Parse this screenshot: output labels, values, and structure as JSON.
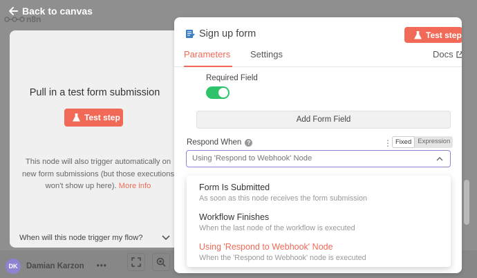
{
  "top": {
    "back_label": "Back to canvas",
    "logo_text": "n8n"
  },
  "left_panel": {
    "title": "Pull in a test form submission",
    "test_button": "Test step",
    "description": "This node will also trigger automatically on new form submissions (but those executions won't show up here).",
    "more_info": "More info",
    "footer_question": "When will this node trigger my flow?"
  },
  "user": {
    "initials": "DK",
    "name": "Damian Karzon",
    "menu": "•••"
  },
  "node_panel": {
    "title": "Sign up form",
    "test_button": "Test step",
    "tabs": [
      {
        "label": "Parameters",
        "active": true
      },
      {
        "label": "Settings",
        "active": false
      }
    ],
    "docs_label": "Docs",
    "required_field_label": "Required Field",
    "required_field_on": true,
    "add_field_button": "Add Form Field",
    "respond_when": {
      "label": "Respond When",
      "help": "?",
      "mode_fixed": "Fixed",
      "mode_expression": "Expression",
      "value": "Using 'Respond to Webhook' Node"
    }
  },
  "dropdown": {
    "options": [
      {
        "title": "Form Is Submitted",
        "desc": "As soon as this node receives the form submission",
        "selected": false
      },
      {
        "title": "Workflow Finishes",
        "desc": "When the last node of the workflow is executed",
        "selected": false
      },
      {
        "title": "Using 'Respond to Webhook' Node",
        "desc": "When the 'Respond to Webhook' node is executed",
        "selected": true
      }
    ]
  },
  "colors": {
    "accent": "#f06a57",
    "toggle_on": "#2ec36a",
    "focus_border": "#8b84d9"
  }
}
